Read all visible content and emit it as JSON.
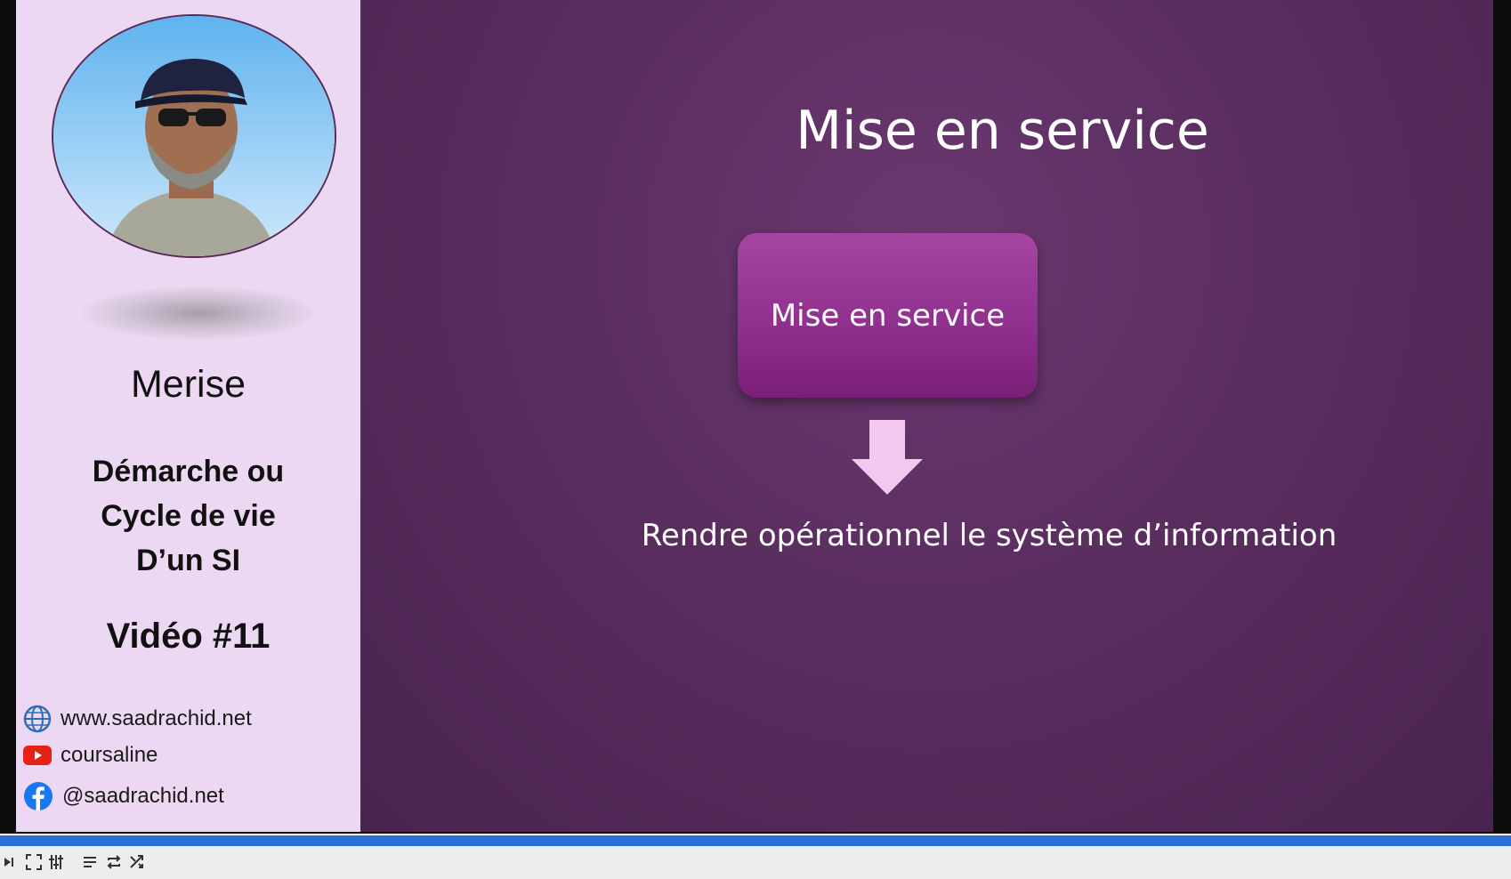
{
  "sidebar": {
    "course": "Merise",
    "description_lines": [
      "Démarche ou",
      "Cycle de vie",
      "D’un SI"
    ],
    "video_number": "Vidéo #11",
    "links": [
      {
        "icon": "globe-icon",
        "text": "www.saadrachid.net"
      },
      {
        "icon": "youtube-icon",
        "text": "coursaline"
      },
      {
        "icon": "facebook-icon",
        "text": "@saadrachid.net"
      }
    ]
  },
  "slide": {
    "title": "Mise en service",
    "box_label": "Mise en service",
    "subtext": "Rendre opérationnel le système d’information"
  },
  "player": {
    "progress": 0.997,
    "controls": [
      "next-icon",
      "fullscreen-icon",
      "settings-icon",
      "playlist-icon",
      "loop-icon",
      "shuffle-icon"
    ]
  },
  "colors": {
    "slide_bg": "#5a2d5f",
    "box": "#9a3a97",
    "sidebar_bg": "#ecd8f3",
    "progress": "#2a6fd6"
  }
}
